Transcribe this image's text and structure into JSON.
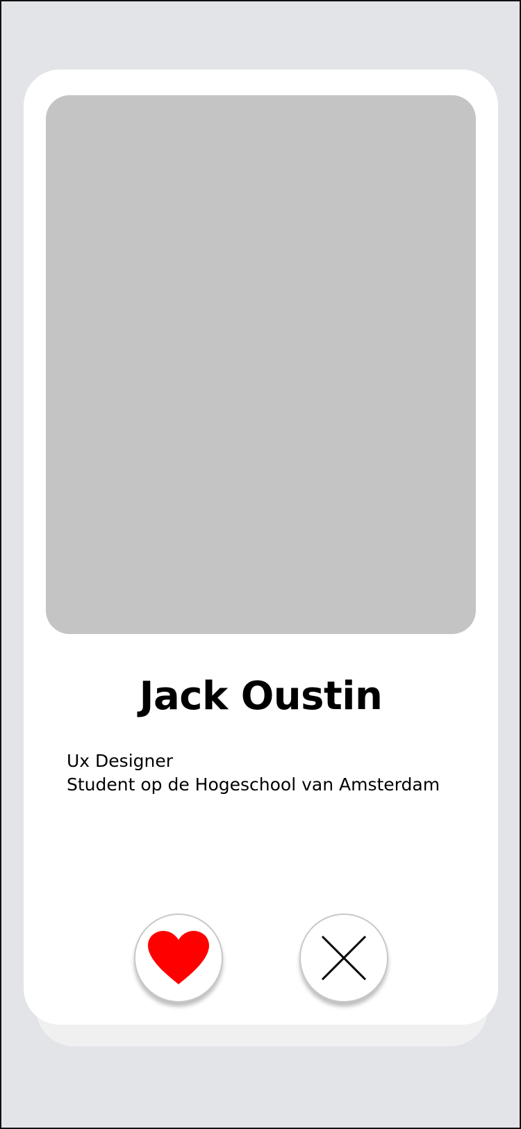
{
  "profile": {
    "name": "Jack Oustin",
    "bio_lines": [
      "Ux Designer",
      "Student op de Hogeschool van Amsterdam"
    ]
  },
  "actions": {
    "like_icon": "heart-icon",
    "dislike_icon": "close-icon"
  },
  "colors": {
    "background": "#e2e4e8",
    "card": "#ffffff",
    "photo_placeholder": "#c4c4c4",
    "heart": "#ff0000"
  }
}
